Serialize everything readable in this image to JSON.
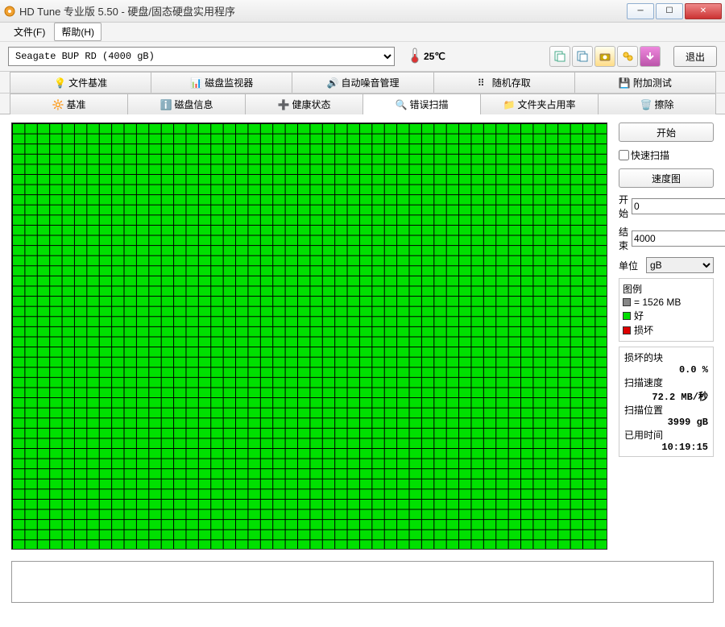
{
  "window": {
    "title": "HD Tune 专业版 5.50 - 硬盘/固态硬盘实用程序"
  },
  "menu": {
    "file": "文件(F)",
    "help": "帮助(H)"
  },
  "toolbar": {
    "drive": "Seagate BUP RD (4000 gB)",
    "temp": "25℃",
    "exit": "退出"
  },
  "tabs_row1": {
    "file_benchmark": "文件基准",
    "disk_monitor": "磁盘监视器",
    "aam": "自动噪音管理",
    "random_access": "随机存取",
    "extra_tests": "附加测试"
  },
  "tabs_row2": {
    "benchmark": "基准",
    "info": "磁盘信息",
    "health": "健康状态",
    "error_scan": "错误扫描",
    "folder_usage": "文件夹占用率",
    "erase": "擦除"
  },
  "side": {
    "start": "开始",
    "quick_scan": "快速扫描",
    "speed_map": "速度图",
    "start_lbl": "开始",
    "start_val": "0",
    "end_lbl": "结束",
    "end_val": "4000",
    "unit_lbl": "单位",
    "unit_val": "gB"
  },
  "legend": {
    "title": "图例",
    "block_size": "= 1526 MB",
    "good": "好",
    "bad": "损坏"
  },
  "stats": {
    "damaged_blocks_lbl": "损坏的块",
    "damaged_blocks_val": "0.0 %",
    "scan_speed_lbl": "扫描速度",
    "scan_speed_val": "72.2 MB/秒",
    "scan_pos_lbl": "扫描位置",
    "scan_pos_val": "3999 gB",
    "elapsed_lbl": "已用时间",
    "elapsed_val": "10:19:15"
  }
}
